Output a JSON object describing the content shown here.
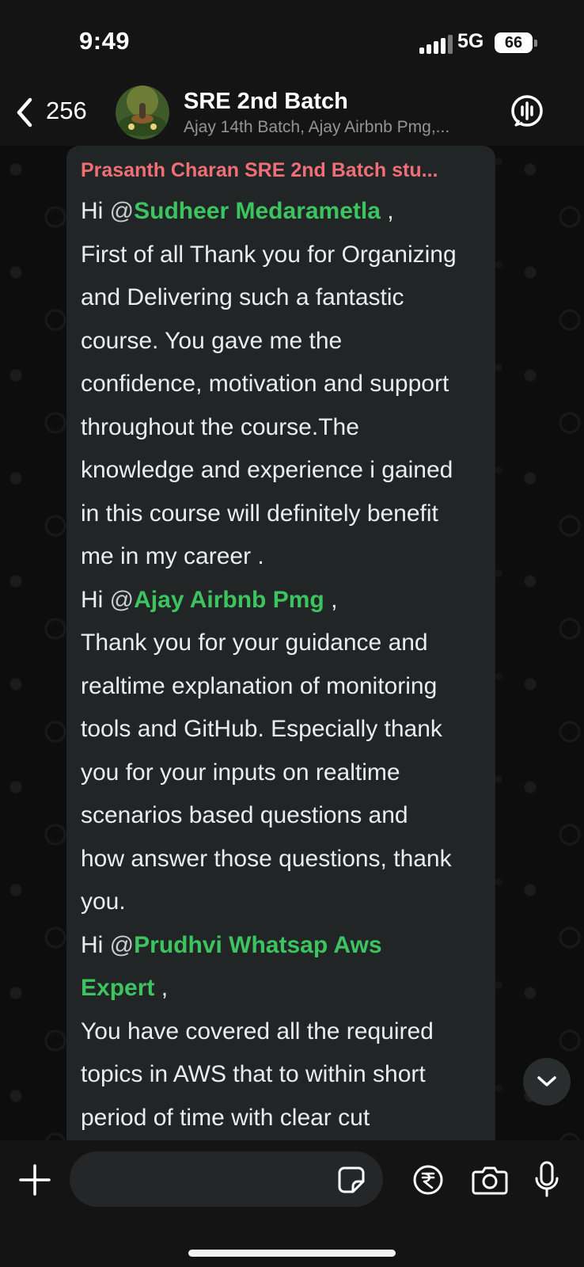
{
  "status_bar": {
    "time": "9:49",
    "network": "5G",
    "battery": "66"
  },
  "header": {
    "back_count": "256",
    "group_name": "SRE 2nd Batch",
    "members": "Ajay 14th Batch, Ajay Airbnb Pmg,..."
  },
  "message": {
    "sender": "Prasanth Charan SRE 2nd Batch stu...",
    "lines": [
      {
        "pre": "Hi ",
        "at": "@",
        "mention": "Sudheer Medarametla",
        "post": " ,"
      },
      {
        "text": "First of all Thank you for Organizing"
      },
      {
        "text": "and Delivering such a fantastic"
      },
      {
        "text": "course. You gave me the"
      },
      {
        "text": "confidence, motivation and support"
      },
      {
        "text": "throughout  the course.The"
      },
      {
        "text": "knowledge and experience i gained"
      },
      {
        "text": "in this course will definitely benefit"
      },
      {
        "text": "me in my career ."
      },
      {
        "pre": "Hi ",
        "at": "@",
        "mention": "Ajay Airbnb Pmg",
        "post": " ,"
      },
      {
        "text": "Thank you for your guidance and"
      },
      {
        "text": "realtime explanation of monitoring"
      },
      {
        "text": "tools and GitHub. Especially thank"
      },
      {
        "text": "you for your inputs on realtime"
      },
      {
        "text": "scenarios based questions and"
      },
      {
        "text": "how answer those questions, thank"
      },
      {
        "text": "you."
      },
      {
        "pre": "Hi ",
        "at": "@",
        "mention": "Prudhvi Whatsap Aws",
        "post": ""
      },
      {
        "pre": "",
        "at": "",
        "mention": "Expert",
        "post": " ,"
      },
      {
        "text": "You have covered all the required"
      },
      {
        "text": "topics in AWS that to within short"
      },
      {
        "text": "period of time with clear cut"
      }
    ]
  },
  "input": {
    "placeholder": ""
  },
  "colors": {
    "mention": "#3cc461",
    "sender": "#ef6f77",
    "bubble": "#222525"
  }
}
